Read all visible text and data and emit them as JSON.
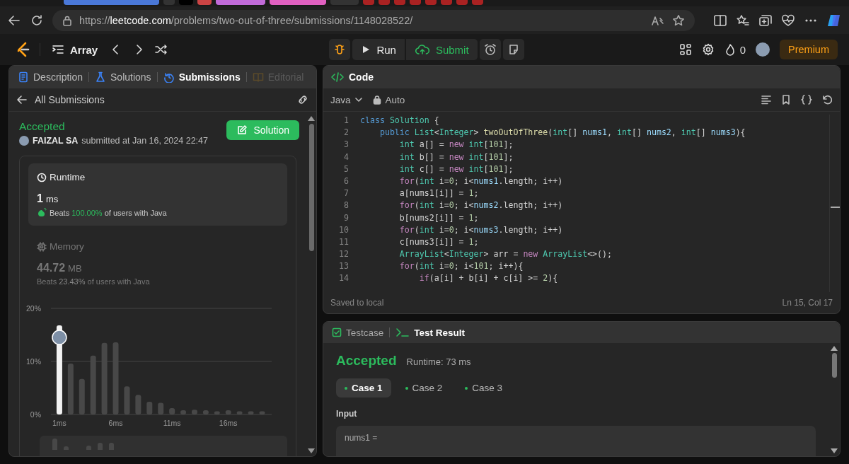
{
  "browser": {
    "url": {
      "scheme": "https://",
      "host": "leetcode.com",
      "path": "/problems/two-out-of-three/submissions/1148028522/"
    }
  },
  "nav": {
    "problem_list": "Array",
    "run": "Run",
    "submit": "Submit",
    "streak": "0",
    "premium": "Premium"
  },
  "left_tabs": [
    {
      "label": "Description",
      "selected": false,
      "disabled": false
    },
    {
      "label": "Solutions",
      "selected": false,
      "disabled": false
    },
    {
      "label": "Submissions",
      "selected": true,
      "disabled": false
    },
    {
      "label": "Editorial",
      "selected": false,
      "disabled": true
    }
  ],
  "submission": {
    "back": "All Submissions",
    "status": "Accepted",
    "user": "FAIZAL SA",
    "submitted": "submitted at Jan 16, 2024 22:47",
    "solution_button": "Solution",
    "stats": [
      {
        "kind": "runtime",
        "title": "Runtime",
        "value": "1",
        "unit": "ms",
        "beats_label": "Beats",
        "beats": "100.00%",
        "beats_suffix": "of users with Java",
        "selected": true
      },
      {
        "kind": "memory",
        "title": "Memory",
        "value": "44.72",
        "unit": "MB",
        "beats_label": "Beats",
        "beats": "23.43%",
        "beats_suffix": "of users with Java",
        "selected": false
      }
    ],
    "chart_data": {
      "type": "bar",
      "x": [
        1,
        2,
        3,
        4,
        5,
        6,
        7,
        8,
        9,
        10,
        11,
        12,
        13,
        14,
        15,
        16,
        17,
        18,
        19
      ],
      "series": [
        {
          "color": "#484848",
          "values": [
            null,
            9.6,
            6.7,
            11.1,
            13.5,
            13.6,
            5.3,
            3.7,
            2.4,
            2.2,
            1.2,
            0.8,
            0.9,
            0.8,
            0.6,
            0.8,
            0.6,
            0.6,
            0.6
          ]
        },
        {
          "color": "#f2f2f2",
          "values": [
            16.8,
            null,
            null,
            null,
            null,
            null,
            null,
            null,
            null,
            null,
            null,
            null,
            null,
            null,
            null,
            null,
            null,
            null,
            null
          ]
        }
      ],
      "xlim": [
        0.25,
        19.85
      ],
      "ylim": [
        0,
        20
      ],
      "yticks": [
        {
          "value": 0,
          "label": "0%"
        },
        {
          "value": 10,
          "label": "10%"
        },
        {
          "value": 20,
          "label": "20%"
        }
      ],
      "xticks": [
        {
          "value": 1,
          "label": "1ms"
        },
        {
          "value": 6,
          "label": "6ms"
        },
        {
          "value": 11,
          "label": "11ms"
        },
        {
          "value": 16,
          "label": "16ms"
        }
      ]
    }
  },
  "code": {
    "title": "Code",
    "language": "Java",
    "mode": "Auto",
    "status": "Saved to local",
    "cursor": "Ln 15, Col 17",
    "lines": [
      {
        "number": "1",
        "tokens": [
          {
            "kind": "kw",
            "text": "class"
          },
          {
            "kind": "type",
            "text": " Solution"
          },
          {
            "kind": "p",
            "text": " {"
          }
        ]
      },
      {
        "number": "2",
        "tokens": [
          {
            "kind": "kw",
            "text": "    public"
          },
          {
            "kind": "type",
            "text": " List"
          },
          {
            "kind": "p",
            "text": "<"
          },
          {
            "kind": "type",
            "text": "Integer"
          },
          {
            "kind": "p",
            "text": ">"
          },
          {
            "kind": "fn",
            "text": " twoOutOfThree"
          },
          {
            "kind": "p",
            "text": "("
          },
          {
            "kind": "type",
            "text": "int"
          },
          {
            "kind": "p",
            "text": "[]"
          },
          {
            "kind": "var",
            "text": " nums1"
          },
          {
            "kind": "p",
            "text": ","
          },
          {
            "kind": "type",
            "text": " int"
          },
          {
            "kind": "p",
            "text": "[]"
          },
          {
            "kind": "var",
            "text": " nums2"
          },
          {
            "kind": "p",
            "text": ","
          },
          {
            "kind": "type",
            "text": " int"
          },
          {
            "kind": "p",
            "text": "[]"
          },
          {
            "kind": "var",
            "text": " nums3"
          },
          {
            "kind": "p",
            "text": "){"
          }
        ]
      },
      {
        "number": "3",
        "tokens": [
          {
            "kind": "type",
            "text": "        int"
          },
          {
            "kind": "p",
            "text": " a[] ="
          },
          {
            "kind": "ctl",
            "text": " new"
          },
          {
            "kind": "type",
            "text": " int"
          },
          {
            "kind": "p",
            "text": "["
          },
          {
            "kind": "num",
            "text": "101"
          },
          {
            "kind": "p",
            "text": "];"
          }
        ]
      },
      {
        "number": "4",
        "tokens": [
          {
            "kind": "type",
            "text": "        int"
          },
          {
            "kind": "p",
            "text": " b[] ="
          },
          {
            "kind": "ctl",
            "text": " new"
          },
          {
            "kind": "type",
            "text": " int"
          },
          {
            "kind": "p",
            "text": "["
          },
          {
            "kind": "num",
            "text": "101"
          },
          {
            "kind": "p",
            "text": "];"
          }
        ]
      },
      {
        "number": "5",
        "tokens": [
          {
            "kind": "type",
            "text": "        int"
          },
          {
            "kind": "p",
            "text": " c[] ="
          },
          {
            "kind": "ctl",
            "text": " new"
          },
          {
            "kind": "type",
            "text": " int"
          },
          {
            "kind": "p",
            "text": "["
          },
          {
            "kind": "num",
            "text": "101"
          },
          {
            "kind": "p",
            "text": "];"
          }
        ]
      },
      {
        "number": "6",
        "tokens": [
          {
            "kind": "ctl",
            "text": "        for"
          },
          {
            "kind": "p",
            "text": "("
          },
          {
            "kind": "type",
            "text": "int"
          },
          {
            "kind": "p",
            "text": " i="
          },
          {
            "kind": "num",
            "text": "0"
          },
          {
            "kind": "p",
            "text": "; i<"
          },
          {
            "kind": "var",
            "text": "nums1"
          },
          {
            "kind": "p",
            "text": ".length; i++)"
          }
        ]
      },
      {
        "number": "7",
        "tokens": [
          {
            "kind": "p",
            "text": "        a[nums1[i]] = "
          },
          {
            "kind": "num",
            "text": "1"
          },
          {
            "kind": "p",
            "text": ";"
          }
        ]
      },
      {
        "number": "8",
        "tokens": [
          {
            "kind": "ctl",
            "text": "        for"
          },
          {
            "kind": "p",
            "text": "("
          },
          {
            "kind": "type",
            "text": "int"
          },
          {
            "kind": "p",
            "text": " i="
          },
          {
            "kind": "num",
            "text": "0"
          },
          {
            "kind": "p",
            "text": "; i<"
          },
          {
            "kind": "var",
            "text": "nums2"
          },
          {
            "kind": "p",
            "text": ".length; i++)"
          }
        ]
      },
      {
        "number": "9",
        "tokens": [
          {
            "kind": "p",
            "text": "        b[nums2[i]] = "
          },
          {
            "kind": "num",
            "text": "1"
          },
          {
            "kind": "p",
            "text": ";"
          }
        ]
      },
      {
        "number": "10",
        "tokens": [
          {
            "kind": "ctl",
            "text": "        for"
          },
          {
            "kind": "p",
            "text": "("
          },
          {
            "kind": "type",
            "text": "int"
          },
          {
            "kind": "p",
            "text": " i="
          },
          {
            "kind": "num",
            "text": "0"
          },
          {
            "kind": "p",
            "text": "; i<"
          },
          {
            "kind": "var",
            "text": "nums3"
          },
          {
            "kind": "p",
            "text": ".length; i++)"
          }
        ]
      },
      {
        "number": "11",
        "tokens": [
          {
            "kind": "p",
            "text": "        c[nums3[i]] = "
          },
          {
            "kind": "num",
            "text": "1"
          },
          {
            "kind": "p",
            "text": ";"
          }
        ]
      },
      {
        "number": "12",
        "tokens": [
          {
            "kind": "type",
            "text": "        ArrayList"
          },
          {
            "kind": "p",
            "text": "<"
          },
          {
            "kind": "type",
            "text": "Integer"
          },
          {
            "kind": "p",
            "text": "> arr ="
          },
          {
            "kind": "ctl",
            "text": " new"
          },
          {
            "kind": "type",
            "text": " ArrayList"
          },
          {
            "kind": "p",
            "text": "<>();"
          }
        ]
      },
      {
        "number": "13",
        "tokens": [
          {
            "kind": "ctl",
            "text": "        for"
          },
          {
            "kind": "p",
            "text": "("
          },
          {
            "kind": "type",
            "text": "int"
          },
          {
            "kind": "p",
            "text": " i="
          },
          {
            "kind": "num",
            "text": "0"
          },
          {
            "kind": "p",
            "text": "; i<"
          },
          {
            "kind": "num",
            "text": "101"
          },
          {
            "kind": "p",
            "text": "; i++){"
          }
        ]
      },
      {
        "number": "14",
        "tokens": [
          {
            "kind": "ctl",
            "text": "            if"
          },
          {
            "kind": "p",
            "text": "(a[i] + b[i] + c[i] >= "
          },
          {
            "kind": "num",
            "text": "2"
          },
          {
            "kind": "p",
            "text": "){"
          }
        ]
      }
    ]
  },
  "test": {
    "tabs": [
      {
        "label": "Testcase",
        "selected": false
      },
      {
        "label": "Test Result",
        "selected": true
      }
    ],
    "status": "Accepted",
    "runtime": "Runtime: 73 ms",
    "cases": [
      {
        "label": "Case 1",
        "selected": true
      },
      {
        "label": "Case 2",
        "selected": false
      },
      {
        "label": "Case 3",
        "selected": false
      }
    ],
    "input_label": "Input",
    "params": [
      {
        "name": "nums1 ="
      }
    ]
  }
}
